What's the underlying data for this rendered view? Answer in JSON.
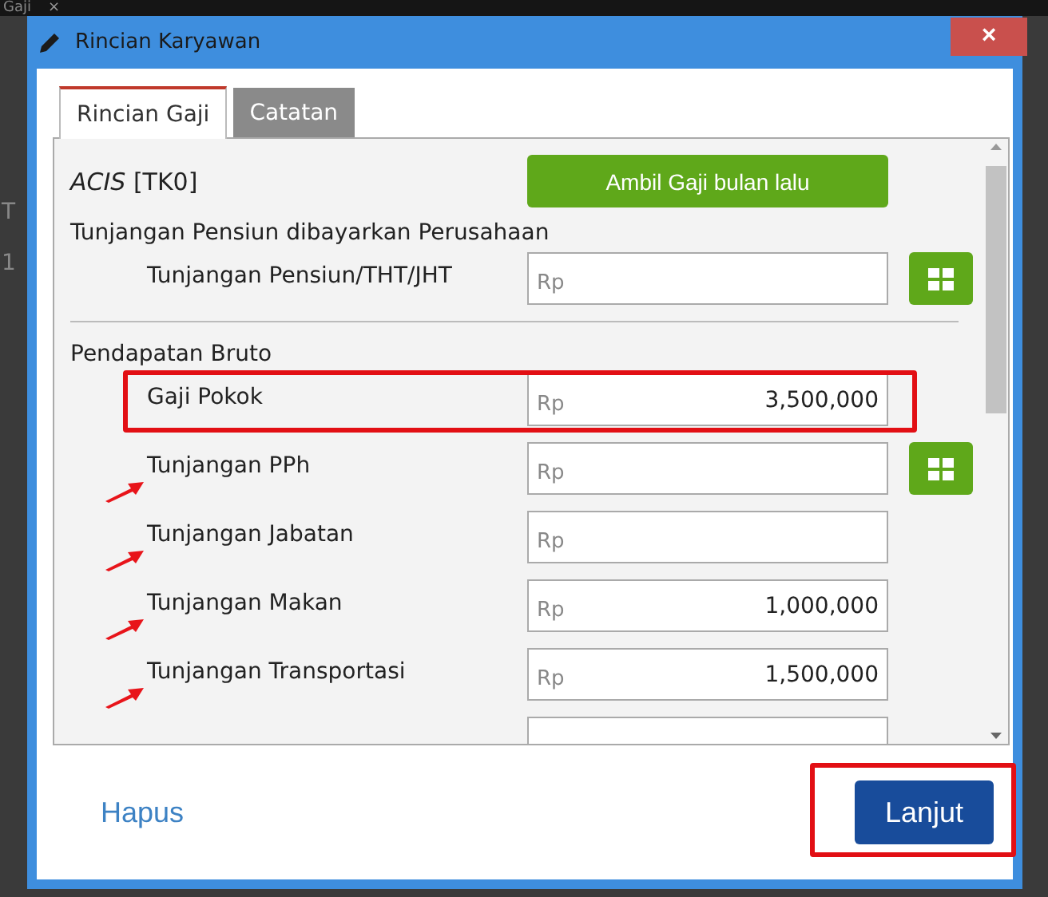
{
  "background": {
    "tab_label": "Gaji",
    "tab_close": "×",
    "cells": [
      "T",
      "1"
    ]
  },
  "window": {
    "title": "Rincian Karyawan",
    "close": "×"
  },
  "tabs": [
    {
      "label": "Rincian Gaji",
      "selected": true
    },
    {
      "label": "Catatan",
      "selected": false
    }
  ],
  "employee": "*ACIS* [TK0]",
  "copy_button": "Ambil Gaji bulan lalu",
  "sections": [
    {
      "title": "Tunjangan Pensiun dibayarkan Perusahaan",
      "divider": true,
      "rows": [
        {
          "label": "Tunjangan Pensiun/THT/JHT",
          "prefix": "Rp",
          "calculator": true,
          "highlighted": false,
          "arrow": false
        }
      ]
    },
    {
      "title": "Pendapatan Bruto",
      "divider": false,
      "rows": [
        {
          "label": "Gaji Pokok",
          "prefix": "Rp",
          "value": "3,500,000",
          "calculator": false,
          "highlighted": true,
          "arrow": false
        },
        {
          "label": "Tunjangan PPh",
          "prefix": "Rp",
          "calculator": true,
          "highlighted": false,
          "arrow": true
        },
        {
          "label": "Tunjangan Jabatan",
          "prefix": "Rp",
          "calculator": false,
          "highlighted": false,
          "arrow": true
        },
        {
          "label": "Tunjangan Makan",
          "prefix": "Rp",
          "value": "1,000,000",
          "calculator": false,
          "highlighted": false,
          "arrow": true
        },
        {
          "label": "Tunjangan Transportasi",
          "prefix": "Rp",
          "value": "1,500,000",
          "calculator": false,
          "highlighted": false,
          "arrow": true
        },
        {
          "calculator": false,
          "highlighted": false
        }
      ]
    }
  ],
  "footer": {
    "delete_link": "Hapus",
    "next_button": {
      "label": "Lanjut",
      "highlighted": true
    }
  }
}
